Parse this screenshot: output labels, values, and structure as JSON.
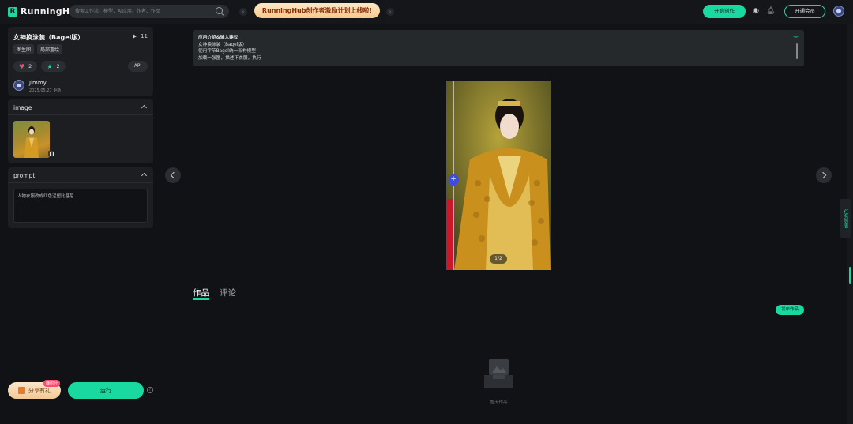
{
  "header": {
    "logo_text": "RunningHUB",
    "search_placeholder": "搜索工作流、模型、AI应用、作者、作品",
    "banner_text": "RunningHub创作者激励计划上线啦!",
    "create_label": "开始创作",
    "vip_label": "开通会员"
  },
  "app_info": {
    "title": "女神换泳装（Bagel版）",
    "run_count": "11",
    "tags": [
      "图生图",
      "局部重绘"
    ],
    "likes": "2",
    "favorites": "2",
    "api_label": "API",
    "author": "Jimmy",
    "date": "2025.05.27 更新"
  },
  "image_section": {
    "title": "image"
  },
  "prompt_section": {
    "title": "prompt",
    "value": "人物衣服改成红色泥塑比基尼"
  },
  "footer": {
    "share_label": "分享有礼",
    "share_badge": "赚积分",
    "run_label": "运行",
    "help": "?"
  },
  "intro": {
    "lines": [
      "应用介绍&输入建议",
      "女神换泳装（Bagel版）",
      "使用字节Bagel统一架构模型",
      "加载一张图，描述下衣服，执行"
    ]
  },
  "preview": {
    "page_indicator": "1/2"
  },
  "tabs": {
    "works": "作品",
    "comments": "评论"
  },
  "works": {
    "publish_label": "发布作品",
    "empty_text": "暂无作品"
  },
  "side_tab": {
    "label": "任务列表"
  },
  "colors": {
    "accent": "#19d9a0",
    "background": "#101215",
    "panel": "#1c1e22"
  }
}
